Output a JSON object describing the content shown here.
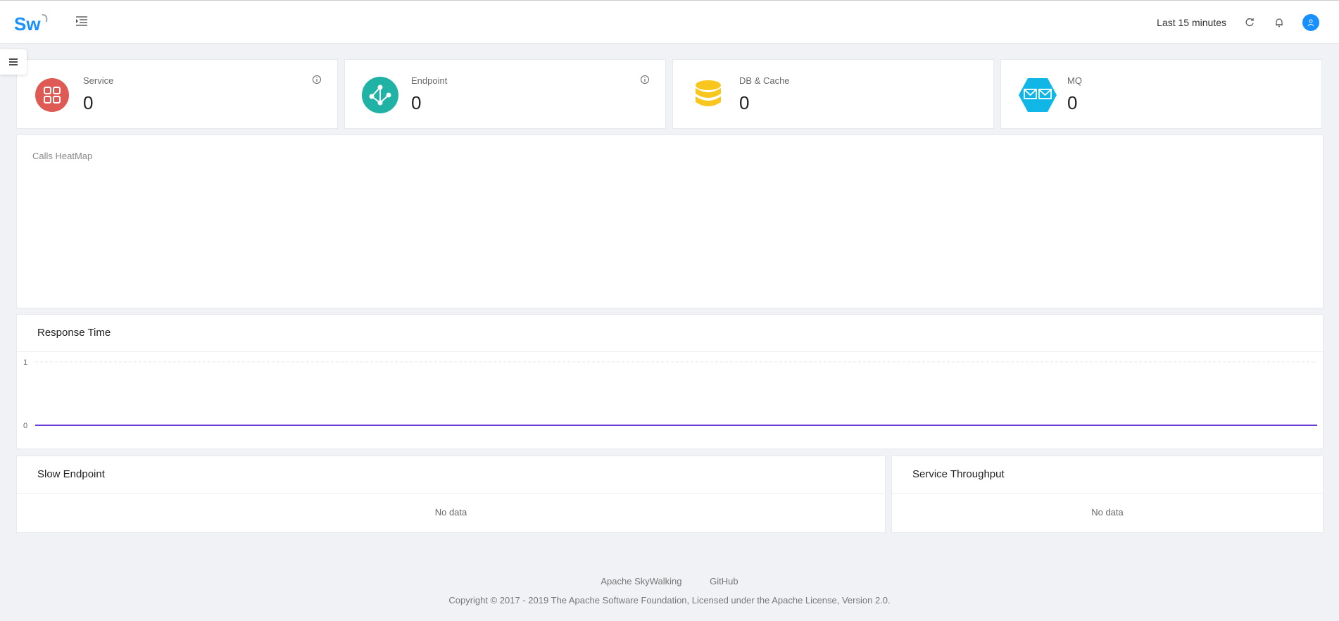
{
  "header": {
    "logo_text": "Sw",
    "time_range": "Last 15 minutes",
    "icons": [
      "menu-fold-icon",
      "refresh-icon",
      "bell-icon",
      "user-icon"
    ],
    "colors": {
      "logo": "#1890ff",
      "avatar": "#1890ff"
    }
  },
  "stats": [
    {
      "label": "Service",
      "value": "0",
      "icon": "apps-grid-icon",
      "color": "#e05a55",
      "has_info": true
    },
    {
      "label": "Endpoint",
      "value": "0",
      "icon": "endpoint-nodes-icon",
      "color": "#21b2a6",
      "has_info": true
    },
    {
      "label": "DB & Cache",
      "value": "0",
      "icon": "database-icon",
      "color": "#f9c61e",
      "has_info": false
    },
    {
      "label": "MQ",
      "value": "0",
      "icon": "message-queue-icon",
      "color": "#10b6e6",
      "has_info": false
    }
  ],
  "heatmap": {
    "title": "Calls HeatMap"
  },
  "response_time": {
    "title": "Response Time",
    "chart_data": {
      "type": "line",
      "series": [
        {
          "values": [
            0,
            0
          ]
        }
      ],
      "ylim": [
        0,
        1
      ],
      "y_ticks": [
        "1",
        "0"
      ],
      "line_color": "#6b3bd6"
    }
  },
  "slow_endpoint": {
    "title": "Slow Endpoint",
    "empty_text": "No data"
  },
  "service_throughput": {
    "title": "Service Throughput",
    "empty_text": "No data"
  },
  "footer": {
    "links": [
      "Apache SkyWalking",
      "GitHub"
    ],
    "copyright": "Copyright © 2017 - 2019 The Apache Software Foundation, Licensed under the Apache License, Version 2.0."
  }
}
